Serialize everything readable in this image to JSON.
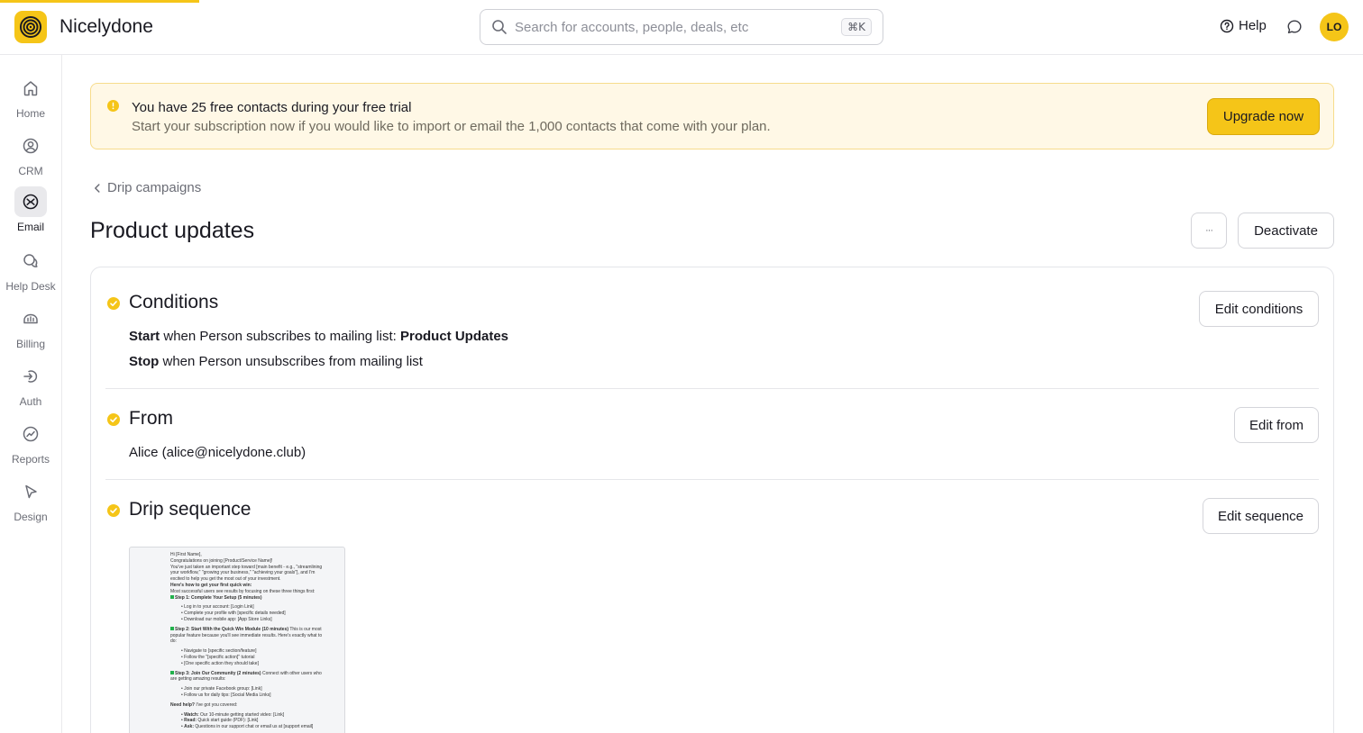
{
  "app": {
    "name": "Nicelydone",
    "accent": "#f5c518",
    "loading_progress": 0.146
  },
  "header": {
    "search_placeholder": "Search for accounts, people, deals, etc",
    "search_shortcut": "⌘K",
    "help_label": "Help",
    "avatar_initials": "LO"
  },
  "sidebar": {
    "items": [
      {
        "label": "Home",
        "icon": "home-icon"
      },
      {
        "label": "CRM",
        "icon": "person-circle-icon"
      },
      {
        "label": "Email",
        "icon": "mail-icon",
        "active": true
      },
      {
        "label": "Help Desk",
        "icon": "chat-bubbles-icon"
      },
      {
        "label": "Billing",
        "icon": "payments-icon"
      },
      {
        "label": "Auth",
        "icon": "sign-in-icon"
      },
      {
        "label": "Reports",
        "icon": "chart-icon"
      },
      {
        "label": "Design",
        "icon": "pointer-icon"
      }
    ]
  },
  "banner": {
    "title": "You have 25 free contacts during your free trial",
    "text": "Start your subscription now if you would like to import or email the 1,000 contacts that come with your plan.",
    "button": "Upgrade now"
  },
  "breadcrumb": {
    "label": "Drip campaigns"
  },
  "page": {
    "title": "Product updates",
    "more_label": "···",
    "deactivate_label": "Deactivate"
  },
  "conditions": {
    "title": "Conditions",
    "button": "Edit conditions",
    "start_keyword": "Start",
    "start_text": "when Person subscribes to mailing list:",
    "start_list": "Product Updates",
    "stop_keyword": "Stop",
    "stop_text": "when Person unsubscribes from mailing list"
  },
  "from": {
    "title": "From",
    "button": "Edit from",
    "value": "Alice (alice@nicelydone.club)"
  },
  "sequence": {
    "title": "Drip sequence",
    "button": "Edit sequence",
    "preview": {
      "l1": "Hi [First Name],",
      "l2": "Congratulations on joining [Product/Service Name]!",
      "l3": "You've just taken an important step toward [main benefit - e.g., \"streamlining",
      "l4": "your workflow,\" \"growing your business,\" \"achieving your goals\"], and I'm",
      "l5": "excited to help you get the most out of your investment.",
      "l6": "Here's how to get your first quick win:",
      "l7": "Most successful users see results by focusing on these three things first:",
      "l8": "Step 1: Complete Your Setup (5 minutes)",
      "l9": "Log in to your account: [Login Link]",
      "l10": "Complete your profile with [specific details needed]",
      "l11": "Download our mobile app: [App Store Links]",
      "l12a": "Step 2: Start With the Quick Win Module (10 minutes)",
      "l12b": " This is our most",
      "l13": "popular feature because you'll see immediate results. Here's exactly what to",
      "l14": "do:",
      "l15": "Navigate to [specific section/feature]",
      "l16": "Follow the \"[specific action]\" tutorial",
      "l17": "[One specific action they should take]",
      "l18a": "Step 3: Join Our Community (2 minutes)",
      "l18b": " Connect with other users who",
      "l19": "are getting amazing results:",
      "l20": "Join our private Facebook group: [Link]",
      "l21": "Follow us for daily tips: [Social Media Links]",
      "l22a": "Need help?",
      "l22b": " I've got you covered:",
      "l23a": "Watch:",
      "l23b": " Our 10-minute getting started video: [Link]",
      "l24a": "Read:",
      "l24b": " Quick start guide (PDF): [Link]",
      "l25a": "Ask:",
      "l25b": " Questions in our support chat or email us at [support email]"
    }
  }
}
